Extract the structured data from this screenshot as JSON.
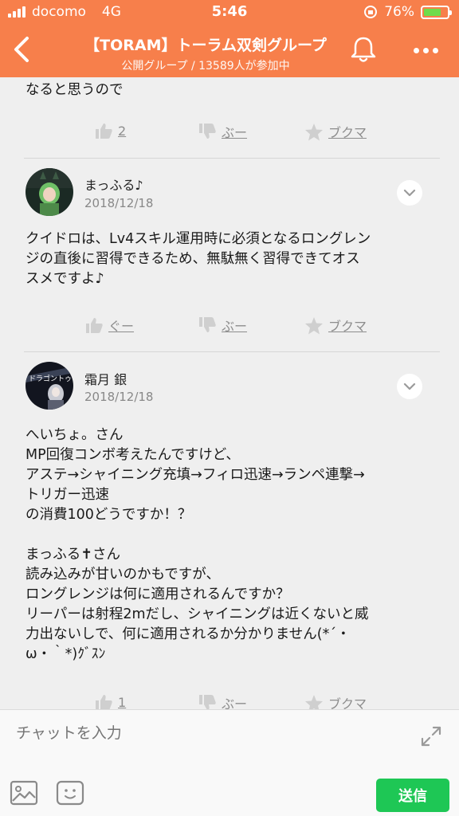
{
  "status_bar": {
    "carrier": "docomo",
    "network": "4G",
    "time": "5:46",
    "battery": "76%"
  },
  "header": {
    "title": "【TORAM】トーラム双剣グループ",
    "subtitle": "公開グループ / 13589人が参加中"
  },
  "posts": [
    {
      "text": "なると思うので",
      "like_label": "2",
      "boo_label": "ぶー",
      "bookmark_label": "ブクマ"
    },
    {
      "author": "まっふる♪",
      "date": "2018/12/18",
      "text": "クイドロは、Lv4スキル運用時に必須となるロングレン\nジの直後に習得できるため、無駄無く習得できてオス\nスメですよ♪",
      "like_label": "ぐー",
      "boo_label": "ぶー",
      "bookmark_label": "ブクマ"
    },
    {
      "author": "霜月 銀",
      "date": "2018/12/18",
      "avatar_text": "ドラゴントゥ",
      "text": "へいちょ。さん\nMP回復コンボ考えたんですけど、\nアステ→シャイニング充填→フィロ迅速→ランペ連撃→\nトリガー迅速\nの消費100どうですか！？\n\nまっふる✝さん\n読み込みが甘いのかもですが、\nロングレンジは何に適用されるんですか？\nリーパーは射程2mだし、シャイニングは近くないと威\n力出ないしで、何に適用されるか分かりません(*´・\nω・｀*)ｸﾞｽﾝ",
      "like_label": "1",
      "boo_label": "ぶー",
      "bookmark_label": "ブクマ"
    }
  ],
  "input_bar": {
    "placeholder": "チャットを入力",
    "send_label": "送信"
  },
  "colors": {
    "header": "#f77f4b",
    "send": "#1ec755"
  }
}
